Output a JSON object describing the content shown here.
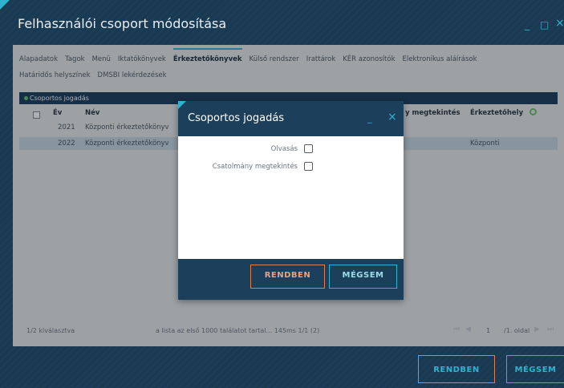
{
  "window": {
    "title": "Felhasználói csoport módosítása",
    "minimize_glyph": "_",
    "maximize_glyph": "□",
    "close_glyph": "×"
  },
  "tabs": [
    {
      "label": "Alapadatok",
      "active": false
    },
    {
      "label": "Tagok",
      "active": false
    },
    {
      "label": "Menü",
      "active": false
    },
    {
      "label": "Iktatókönyvek",
      "active": false
    },
    {
      "label": "Érkeztetőkönyvek",
      "active": true
    },
    {
      "label": "Külső rendszer",
      "active": false
    },
    {
      "label": "Irattárok",
      "active": false
    },
    {
      "label": "KÉR azonosítók",
      "active": false
    },
    {
      "label": "Elektronikus aláírások",
      "active": false
    },
    {
      "label": "Határidős helyszínek",
      "active": false
    },
    {
      "label": "DMSBI lekérdezések",
      "active": false
    }
  ],
  "grid": {
    "toolbar_label": "Csoportos jogadás",
    "columns": {
      "year": "Év",
      "name": "Név",
      "attachment_view": "y megtekintés",
      "station": "Érkeztetőhely"
    },
    "rows": [
      {
        "year": "2021",
        "name": "Központi érkeztetőkönyv",
        "station": "",
        "selected": false
      },
      {
        "year": "2022",
        "name": "Központi érkeztetőkönyv",
        "station": "Központi",
        "selected": true
      }
    ],
    "footer": {
      "selection": "1/2 kiválasztva",
      "info": "a lista az első 1000 találatot tartal...  145ms 1/1 (2)",
      "page": "1",
      "page_total": "/1. oldal"
    }
  },
  "bottom_buttons": {
    "ok": "RENDBEN",
    "cancel": "MÉGSEM"
  },
  "dialog": {
    "title": "Csoportos jogadás",
    "minimize_glyph": "_",
    "close_glyph": "×",
    "options": [
      {
        "label": "Olvasás",
        "checked": false
      },
      {
        "label": "Csatolmány megtekintés",
        "checked": false
      }
    ],
    "ok": "RENDBEN",
    "cancel": "MÉGSEM"
  },
  "colors": {
    "accent": "#2fb3d0",
    "primary_dark": "#1c3f5c",
    "ok_border": "#e07b52"
  },
  "icons": {
    "refresh": "refresh-icon",
    "first_page": "first-page-icon",
    "prev_page": "prev-page-icon",
    "next_page": "next-page-icon",
    "last_page": "last-page-icon"
  }
}
